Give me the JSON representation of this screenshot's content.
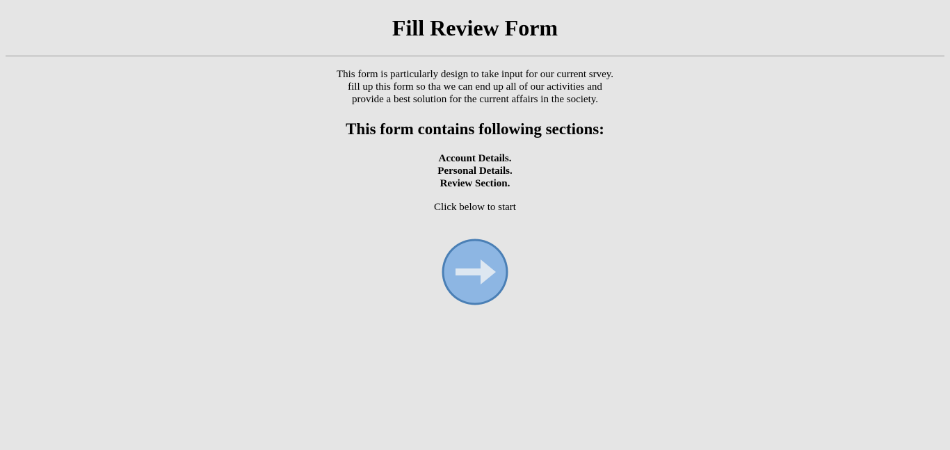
{
  "header": {
    "title": "Fill Review Form"
  },
  "intro": {
    "lines": [
      "This form is particularly design to take input for our current srvey.",
      "fill up this form so tha we can end up all of our activities and",
      "provide a best solution for the current affairs in the society."
    ]
  },
  "sections": {
    "heading": "This form contains following sections:",
    "items": [
      "Account Details.",
      "Personal Details.",
      "Review Section."
    ]
  },
  "start": {
    "prompt": "Click below to start",
    "button_icon": "arrow-right-icon"
  },
  "colors": {
    "background": "#e5e5e5",
    "button_fill": "#8db6e3",
    "button_border": "#4a7fb5",
    "arrow": "#dde7f1"
  }
}
